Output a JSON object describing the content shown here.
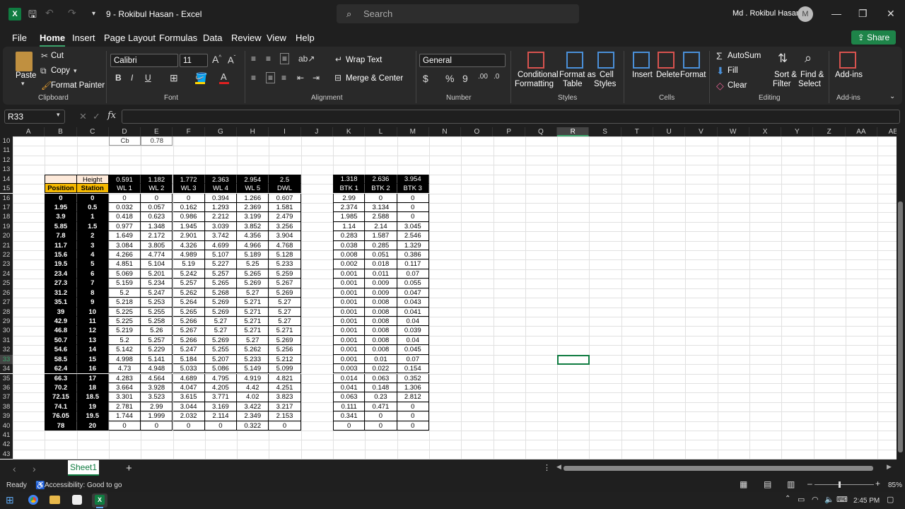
{
  "window": {
    "title": "9 - Rokibul Hasan  -  Excel",
    "app_icon": "X",
    "search_placeholder": "Search",
    "user_name": "Md . Rokibul Hasan",
    "user_initial": "M"
  },
  "menu": [
    "File",
    "Home",
    "Insert",
    "Page Layout",
    "Formulas",
    "Data",
    "Review",
    "View",
    "Help"
  ],
  "share_label": "Share",
  "ribbon": {
    "clipboard": {
      "paste": "Paste",
      "cut": "Cut",
      "copy": "Copy",
      "format_painter": "Format Painter",
      "label": "Clipboard"
    },
    "font": {
      "name": "Calibri",
      "size": "11",
      "label": "Font"
    },
    "alignment": {
      "wrap": "Wrap Text",
      "merge": "Merge & Center",
      "label": "Alignment"
    },
    "number": {
      "format": "General",
      "label": "Number"
    },
    "styles": {
      "cond": "Conditional",
      "cond2": "Formatting",
      "fmt_table": "Format as",
      "fmt_table2": "Table",
      "cell_styles": "Cell",
      "cell_styles2": "Styles",
      "label": "Styles"
    },
    "cells": {
      "insert": "Insert",
      "delete": "Delete",
      "format": "Format",
      "label": "Cells"
    },
    "editing": {
      "autosum": "AutoSum",
      "fill": "Fill",
      "clear": "Clear",
      "sort": "Sort &",
      "sort2": "Filter",
      "find": "Find &",
      "find2": "Select",
      "label": "Editing"
    },
    "addins": {
      "addins": "Add-ins",
      "label": "Add-ins"
    }
  },
  "namebox": "R33",
  "columns": [
    "A",
    "B",
    "C",
    "D",
    "E",
    "F",
    "G",
    "H",
    "I",
    "J",
    "K",
    "L",
    "M",
    "N",
    "O",
    "P",
    "Q",
    "R",
    "S",
    "T",
    "U",
    "V",
    "W",
    "X",
    "Y",
    "Z",
    "AA",
    "AB"
  ],
  "rows": [
    "10",
    "11",
    "12",
    "13",
    "14",
    "15",
    "16",
    "17",
    "18",
    "19",
    "20",
    "21",
    "22",
    "23",
    "24",
    "25",
    "26",
    "27",
    "28",
    "29",
    "30",
    "31",
    "32",
    "33",
    "34",
    "35",
    "36",
    "37",
    "38",
    "39",
    "40",
    "41",
    "42",
    "43"
  ],
  "cb": {
    "label": "Cb",
    "value": "0.78"
  },
  "table1": {
    "hdr1": [
      "",
      "Height",
      "0.591",
      "1.182",
      "1.772",
      "2.363",
      "2.954",
      "2.5"
    ],
    "hdr2": [
      "Position",
      "Station",
      "WL 1",
      "WL 2",
      "WL 3",
      "WL 4",
      "WL 5",
      "DWL"
    ],
    "rows": [
      [
        "0",
        "0",
        "0",
        "0",
        "0",
        "0.394",
        "1.266",
        "0.607"
      ],
      [
        "1.95",
        "0.5",
        "0.032",
        "0.057",
        "0.162",
        "1.293",
        "2.369",
        "1.581"
      ],
      [
        "3.9",
        "1",
        "0.418",
        "0.623",
        "0.986",
        "2.212",
        "3.199",
        "2.479"
      ],
      [
        "5.85",
        "1.5",
        "0.977",
        "1.348",
        "1.945",
        "3.039",
        "3.852",
        "3.256"
      ],
      [
        "7.8",
        "2",
        "1.649",
        "2.172",
        "2.901",
        "3.742",
        "4.356",
        "3.904"
      ],
      [
        "11.7",
        "3",
        "3.084",
        "3.805",
        "4.326",
        "4.699",
        "4.966",
        "4.768"
      ],
      [
        "15.6",
        "4",
        "4.266",
        "4.774",
        "4.989",
        "5.107",
        "5.189",
        "5.128"
      ],
      [
        "19.5",
        "5",
        "4.851",
        "5.104",
        "5.19",
        "5.227",
        "5.25",
        "5.233"
      ],
      [
        "23.4",
        "6",
        "5.069",
        "5.201",
        "5.242",
        "5.257",
        "5.265",
        "5.259"
      ],
      [
        "27.3",
        "7",
        "5.159",
        "5.234",
        "5.257",
        "5.265",
        "5.269",
        "5.267"
      ],
      [
        "31.2",
        "8",
        "5.2",
        "5.247",
        "5.262",
        "5.268",
        "5.27",
        "5.269"
      ],
      [
        "35.1",
        "9",
        "5.218",
        "5.253",
        "5.264",
        "5.269",
        "5.271",
        "5.27"
      ],
      [
        "39",
        "10",
        "5.225",
        "5.255",
        "5.265",
        "5.269",
        "5.271",
        "5.27"
      ],
      [
        "42.9",
        "11",
        "5.225",
        "5.258",
        "5.266",
        "5.27",
        "5.271",
        "5.27"
      ],
      [
        "46.8",
        "12",
        "5.219",
        "5.26",
        "5.267",
        "5.27",
        "5.271",
        "5.271"
      ],
      [
        "50.7",
        "13",
        "5.2",
        "5.257",
        "5.266",
        "5.269",
        "5.27",
        "5.269"
      ],
      [
        "54.6",
        "14",
        "5.142",
        "5.229",
        "5.247",
        "5.255",
        "5.262",
        "5.256"
      ],
      [
        "58.5",
        "15",
        "4.998",
        "5.141",
        "5.184",
        "5.207",
        "5.233",
        "5.212"
      ],
      [
        "62.4",
        "16",
        "4.73",
        "4.948",
        "5.033",
        "5.086",
        "5.149",
        "5.099"
      ],
      [
        "66.3",
        "17",
        "4.283",
        "4.564",
        "4.689",
        "4.795",
        "4.919",
        "4.821"
      ],
      [
        "70.2",
        "18",
        "3.664",
        "3.928",
        "4.047",
        "4.205",
        "4.42",
        "4.251"
      ],
      [
        "72.15",
        "18.5",
        "3.301",
        "3.523",
        "3.615",
        "3.771",
        "4.02",
        "3.823"
      ],
      [
        "74.1",
        "19",
        "2.781",
        "2.99",
        "3.044",
        "3.169",
        "3.422",
        "3.217"
      ],
      [
        "76.05",
        "19.5",
        "1.744",
        "1.999",
        "2.032",
        "2.114",
        "2.349",
        "2.153"
      ],
      [
        "78",
        "20",
        "0",
        "0",
        "0",
        "0",
        "0.322",
        "0"
      ]
    ]
  },
  "table2": {
    "hdr1": [
      "1.318",
      "2.636",
      "3.954"
    ],
    "hdr2": [
      "BTK 1",
      "BTK 2",
      "BTK 3"
    ],
    "rows": [
      [
        "2.99",
        "0",
        "0"
      ],
      [
        "2.374",
        "3.134",
        "0"
      ],
      [
        "1.985",
        "2.588",
        "0"
      ],
      [
        "1.14",
        "2.14",
        "3.045"
      ],
      [
        "0.283",
        "1.587",
        "2.546"
      ],
      [
        "0.038",
        "0.285",
        "1.329"
      ],
      [
        "0.008",
        "0.051",
        "0.386"
      ],
      [
        "0.002",
        "0.018",
        "0.117"
      ],
      [
        "0.001",
        "0.011",
        "0.07"
      ],
      [
        "0.001",
        "0.009",
        "0.055"
      ],
      [
        "0.001",
        "0.009",
        "0.047"
      ],
      [
        "0.001",
        "0.008",
        "0.043"
      ],
      [
        "0.001",
        "0.008",
        "0.041"
      ],
      [
        "0.001",
        "0.008",
        "0.04"
      ],
      [
        "0.001",
        "0.008",
        "0.039"
      ],
      [
        "0.001",
        "0.008",
        "0.04"
      ],
      [
        "0.001",
        "0.008",
        "0.045"
      ],
      [
        "0.001",
        "0.01",
        "0.07"
      ],
      [
        "0.003",
        "0.022",
        "0.154"
      ],
      [
        "0.014",
        "0.063",
        "0.352"
      ],
      [
        "0.041",
        "0.148",
        "1.306"
      ],
      [
        "0.063",
        "0.23",
        "2.812"
      ],
      [
        "0.111",
        "0.471",
        "0"
      ],
      [
        "0.341",
        "0",
        "0"
      ],
      [
        "0",
        "0",
        "0"
      ]
    ]
  },
  "sheet_tab": "Sheet1",
  "status": {
    "ready": "Ready",
    "accessibility": "Accessibility: Good to go",
    "zoom": "85%"
  },
  "taskbar": {
    "time": "2:45 PM"
  }
}
